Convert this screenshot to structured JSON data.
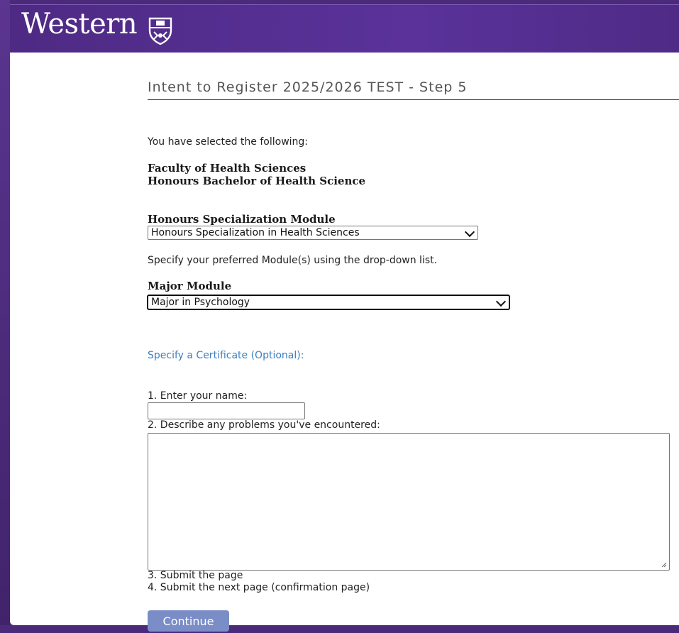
{
  "header": {
    "brand": "Western"
  },
  "page": {
    "title": "Intent to Register 2025/2026 TEST - Step 5",
    "selected_intro": "You have selected the following:",
    "faculty": "Faculty of Health Sciences",
    "degree": "Honours Bachelor of Health Science"
  },
  "modules": {
    "hsm_label": "Honours Specialization Module",
    "hsm_value": "Honours Specialization in Health Sciences",
    "instruction": "Specify your preferred Module(s) using the drop-down list.",
    "major_label": "Major Module",
    "major_value": "Major in Psychology"
  },
  "certificate": {
    "label": "Specify a Certificate (Optional):"
  },
  "steps": {
    "step1": "1. Enter your name:",
    "step2": "2. Describe any problems you've encountered:",
    "step3": "3. Submit the page",
    "step4": "4. Submit the next page (confirmation page)"
  },
  "form": {
    "name_value": "",
    "problems_value": ""
  },
  "actions": {
    "continue_label": "Continue"
  }
}
